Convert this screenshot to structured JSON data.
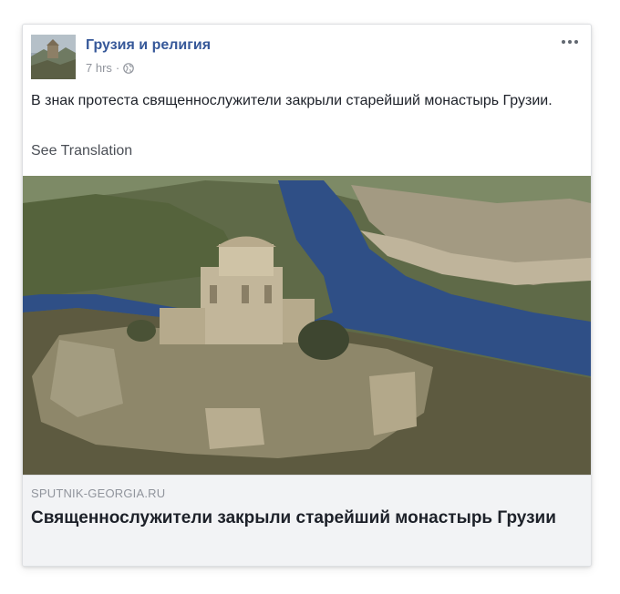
{
  "post": {
    "page_name": "Грузия и религия",
    "time": "7 hrs",
    "separator": "·",
    "privacy_icon": "globe-icon",
    "more_icon": "more-options-icon",
    "text": "В знак протеста священнослужители закрыли старейший монастырь Грузии.",
    "see_translation": "See Translation"
  },
  "link_preview": {
    "domain": "SPUTNIK-GEORGIA.RU",
    "title": "Священнослужители закрыли старейший монастырь Грузии"
  },
  "colors": {
    "link_blue": "#365899",
    "text": "#1d2129",
    "meta_gray": "#90949c",
    "caption_bg": "#f2f3f5"
  }
}
